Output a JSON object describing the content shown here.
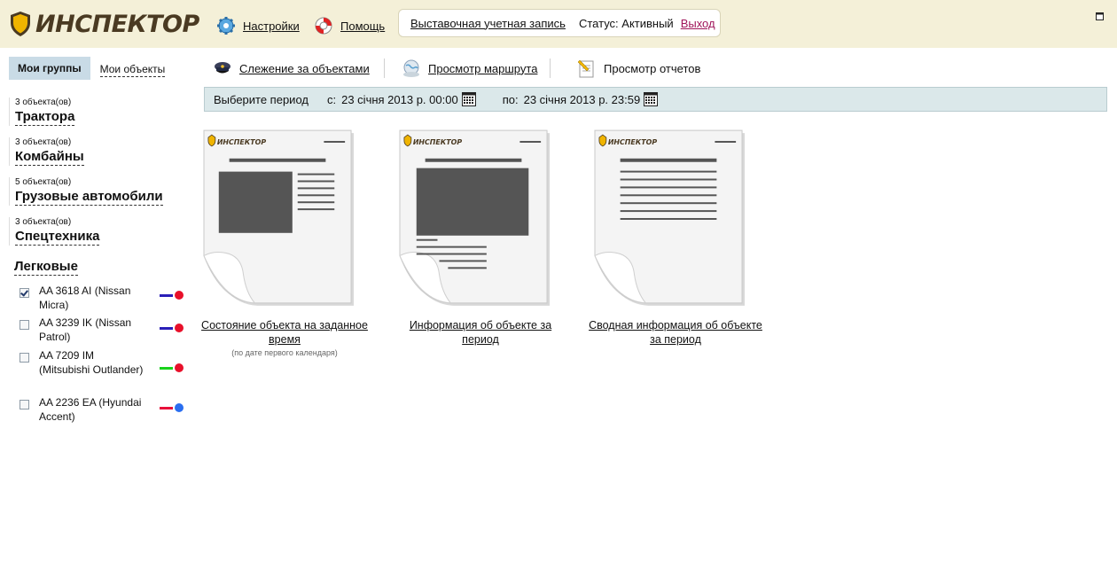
{
  "header": {
    "logo_text": "ИНСПЕКТОР",
    "settings_label": "Настройки",
    "help_label": "Помощь",
    "account_name": "Выставочная учетная запись",
    "status_text": "Статус: Активный",
    "logout_label": "Выход"
  },
  "sidebar": {
    "tab_groups": "Мои группы",
    "tab_objects": "Мои объекты",
    "groups": [
      {
        "count": "3 объекта(ов)",
        "name": "Трактора"
      },
      {
        "count": "3 объекта(ов)",
        "name": "Комбайны"
      },
      {
        "count": "5 объекта(ов)",
        "name": "Грузовые автомобили"
      },
      {
        "count": "3 объекта(ов)",
        "name": "Спецтехника"
      }
    ],
    "open_group": "Легковые",
    "objects": [
      {
        "name": "AA 3618 AI (Nissan Micra)",
        "checked": true,
        "line_color": "#2a1fb8",
        "dot_color": "#e8102a"
      },
      {
        "name": "AA 3239 IK (Nissan Patrol)",
        "checked": false,
        "line_color": "#2a1fb8",
        "dot_color": "#e8102a"
      },
      {
        "name": "AA 7209 IM (Mitsubishi Outlander)",
        "checked": false,
        "line_color": "#19d21c",
        "dot_color": "#e8102a"
      },
      {
        "name": "AA 2236 EA (Hyundai Accent)",
        "checked": false,
        "line_color": "#e8103a",
        "dot_color": "#2a6ef0"
      }
    ]
  },
  "toolbar": {
    "tracking_label": "Слежение за объектами",
    "route_label": "Просмотр маршрута",
    "reports_label": "Просмотр отчетов"
  },
  "period": {
    "label": "Выберите период",
    "from_label": "с:",
    "from_value": "23 січня 2013 р. 00:00",
    "to_label": "по:",
    "to_value": "23 січня 2013 р. 23:59"
  },
  "reports": [
    {
      "title": "Состояние объекта на заданное время",
      "note": "(по дате первого календаря)"
    },
    {
      "title": "Информация об объекте за период",
      "note": ""
    },
    {
      "title": "Сводная информация об объекте за период",
      "note": ""
    }
  ],
  "colors": {
    "header_bg": "#f4f0d8",
    "tab_active_bg": "#c9dbe6",
    "period_bg": "#dbe8ea",
    "logout_color": "#a0155a",
    "logo_color": "#4a3a22",
    "shield_color": "#f0b400"
  },
  "icons": {
    "settings": "gear-icon",
    "help": "lifebuoy-icon",
    "tracking": "police-cap-icon",
    "route": "globe-map-icon",
    "reports": "report-pencil-icon",
    "calendar": "calendar-icon",
    "window": "window-icon"
  }
}
